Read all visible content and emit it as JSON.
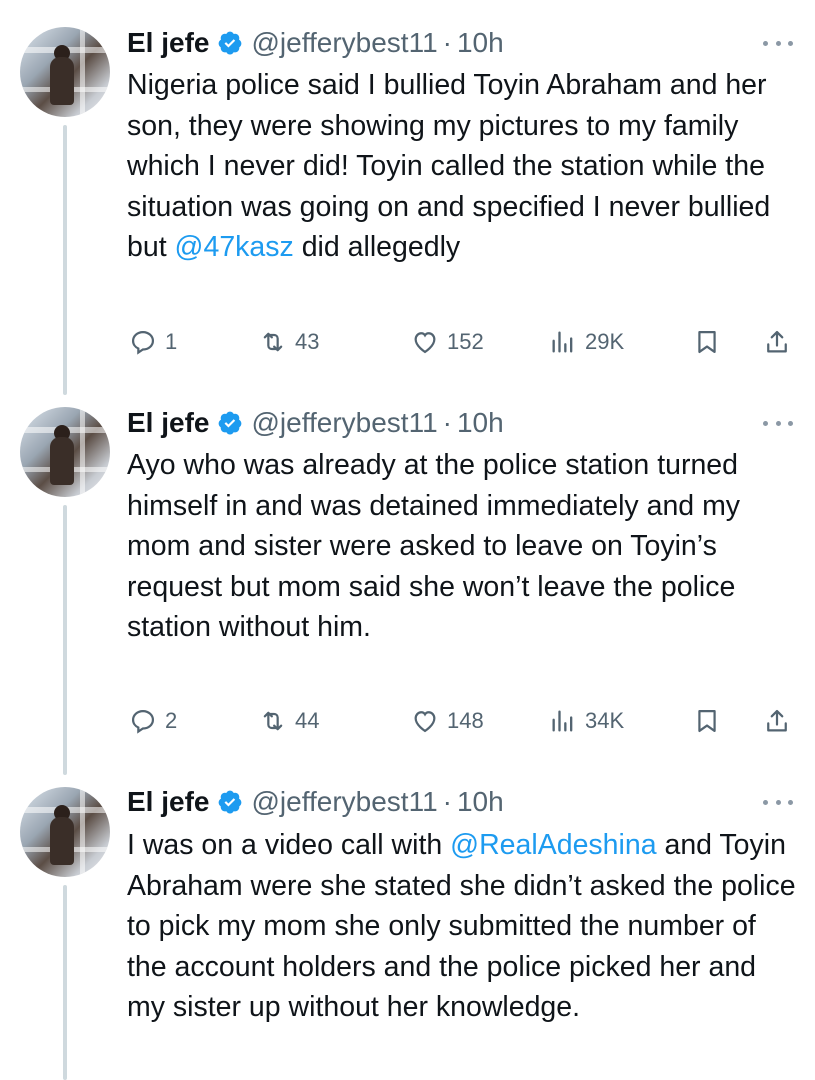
{
  "colors": {
    "accent": "#1d9bf0",
    "secondary_text": "#536471",
    "thread_line": "#cfd9de"
  },
  "tweets": [
    {
      "display_name": "El jefe",
      "handle": "@jefferybest11",
      "separator": "·",
      "time": "10h",
      "text_parts": [
        "Nigeria police said I bullied Toyin Abraham and her son, they were showing my pictures to my family which I never did!  Toyin called the station while the situation was going on and specified I never bullied but ",
        "@47kasz",
        " did allegedly"
      ],
      "replies": "1",
      "reposts": "43",
      "likes": "152",
      "views": "29K"
    },
    {
      "display_name": "El jefe",
      "handle": "@jefferybest11",
      "separator": "·",
      "time": "10h",
      "text_parts": [
        "Ayo who was already at the police station turned himself in and was detained immediately and my mom and sister were asked to leave on Toyin’s request but mom said she won’t leave the police station without him."
      ],
      "replies": "2",
      "reposts": "44",
      "likes": "148",
      "views": "34K"
    },
    {
      "display_name": "El jefe",
      "handle": "@jefferybest11",
      "separator": "·",
      "time": "10h",
      "text_parts": [
        "I was on a video call with ",
        "@RealAdeshina",
        " and Toyin Abraham were she stated she didn’t asked the police to pick my mom she only submitted the number of the account holders and the police picked her and my sister up without her knowledge."
      ]
    }
  ],
  "icons": {
    "more": "more-horizontal-icon",
    "verified": "verified-badge-icon",
    "reply": "reply-icon",
    "repost": "repost-icon",
    "like": "heart-icon",
    "views": "views-icon",
    "bookmark": "bookmark-icon",
    "share": "share-icon"
  }
}
